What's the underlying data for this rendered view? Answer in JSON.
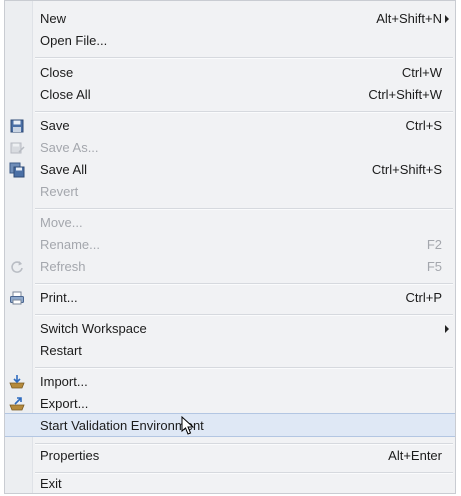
{
  "menu": {
    "new": {
      "label": "New",
      "accel": "Alt+Shift+N"
    },
    "open_file": {
      "label": "Open File..."
    },
    "close": {
      "label": "Close",
      "accel": "Ctrl+W"
    },
    "close_all": {
      "label": "Close All",
      "accel": "Ctrl+Shift+W"
    },
    "save": {
      "label": "Save",
      "accel": "Ctrl+S",
      "icon": "save-icon"
    },
    "save_as": {
      "label": "Save As...",
      "icon": "save-as-icon"
    },
    "save_all": {
      "label": "Save All",
      "accel": "Ctrl+Shift+S",
      "icon": "save-all-icon"
    },
    "revert": {
      "label": "Revert"
    },
    "move": {
      "label": "Move..."
    },
    "rename": {
      "label": "Rename...",
      "accel": "F2"
    },
    "refresh": {
      "label": "Refresh",
      "accel": "F5",
      "icon": "refresh-icon"
    },
    "print": {
      "label": "Print...",
      "accel": "Ctrl+P",
      "icon": "print-icon"
    },
    "switch_workspace": {
      "label": "Switch Workspace"
    },
    "restart": {
      "label": "Restart"
    },
    "import": {
      "label": "Import...",
      "icon": "import-icon"
    },
    "export": {
      "label": "Export...",
      "icon": "export-icon"
    },
    "start_validation": {
      "label": "Start Validation Environment"
    },
    "properties": {
      "label": "Properties",
      "accel": "Alt+Enter"
    },
    "exit": {
      "label": "Exit"
    }
  },
  "colors": {
    "menu_bg": "#f1f2f4",
    "highlight": "#dfe8f5",
    "disabled_text": "#a4a7ad"
  }
}
